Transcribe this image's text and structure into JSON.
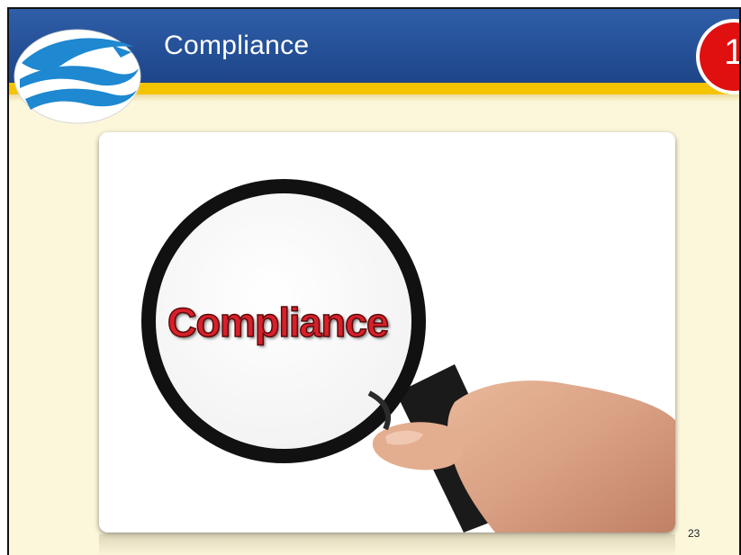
{
  "slide": {
    "title": "Compliance",
    "badge_text": "1",
    "image_text": "Compliance",
    "slide_number": "23"
  },
  "colors": {
    "header_blue": "#244f96",
    "stripe_yellow": "#f5c400",
    "background_cream": "#fcf6db",
    "badge_red": "#e01010",
    "image_text_red": "#d8202a"
  },
  "icons": {
    "logo": "wave-logo-icon",
    "magnifier": "magnifying-glass-icon"
  }
}
